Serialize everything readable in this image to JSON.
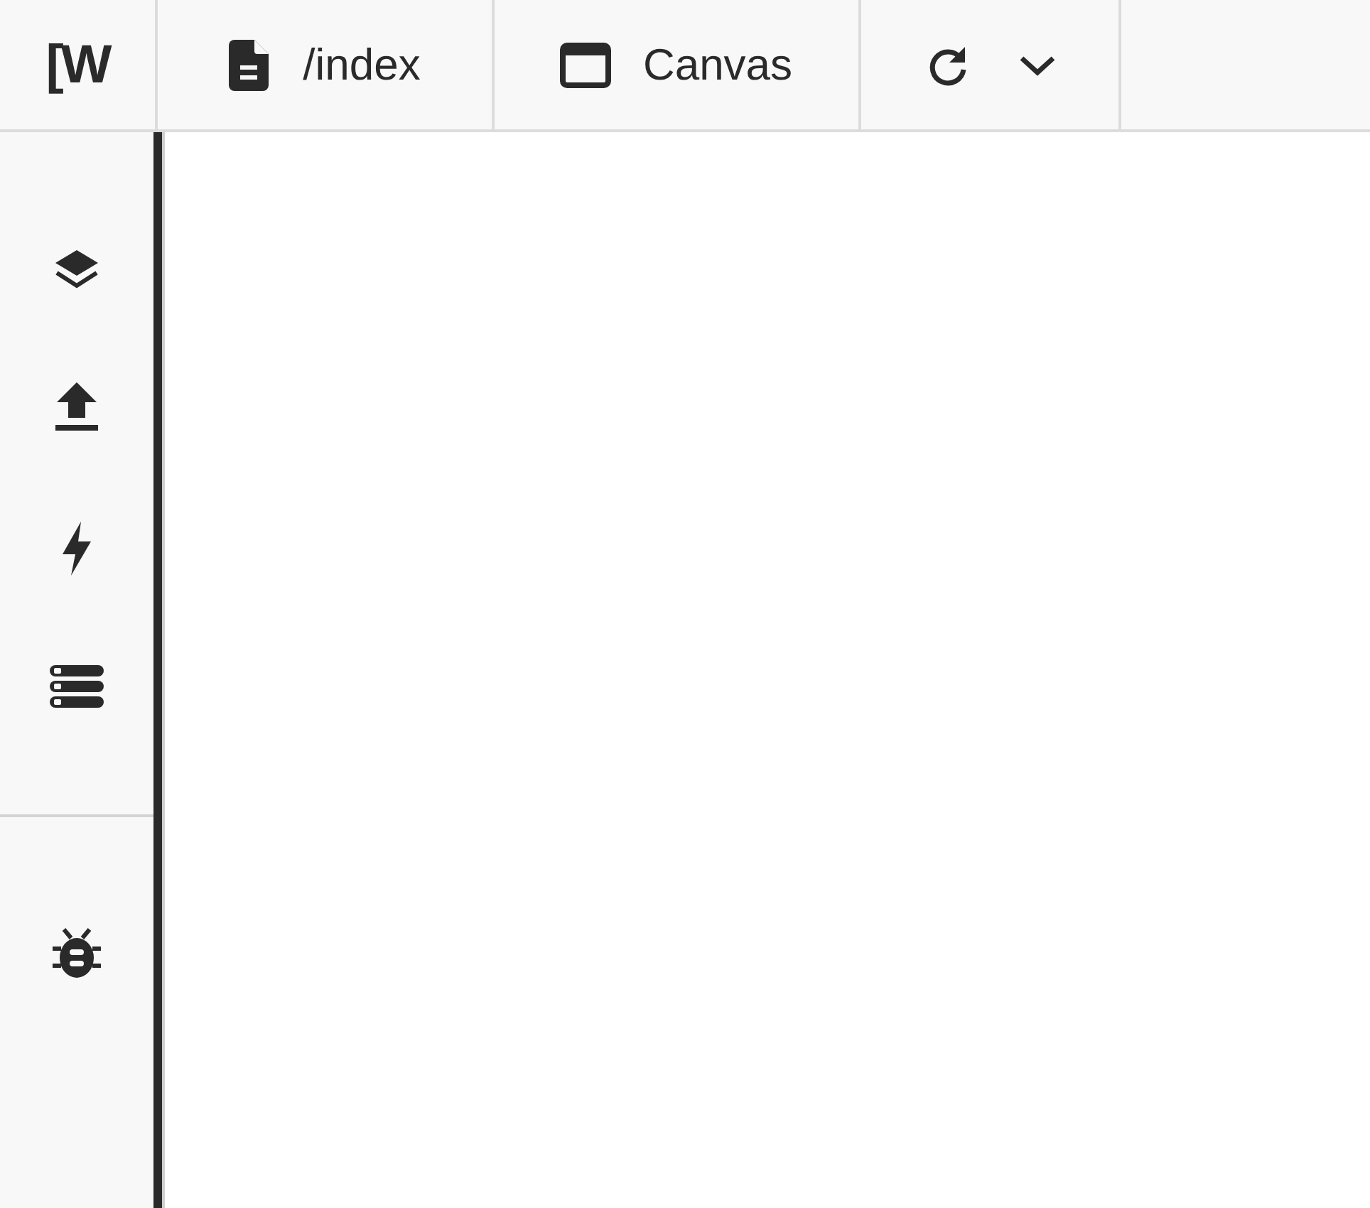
{
  "logo": "[W",
  "tabs": [
    {
      "kind": "page",
      "label": "/index"
    },
    {
      "kind": "window",
      "label": "Canvas"
    }
  ]
}
